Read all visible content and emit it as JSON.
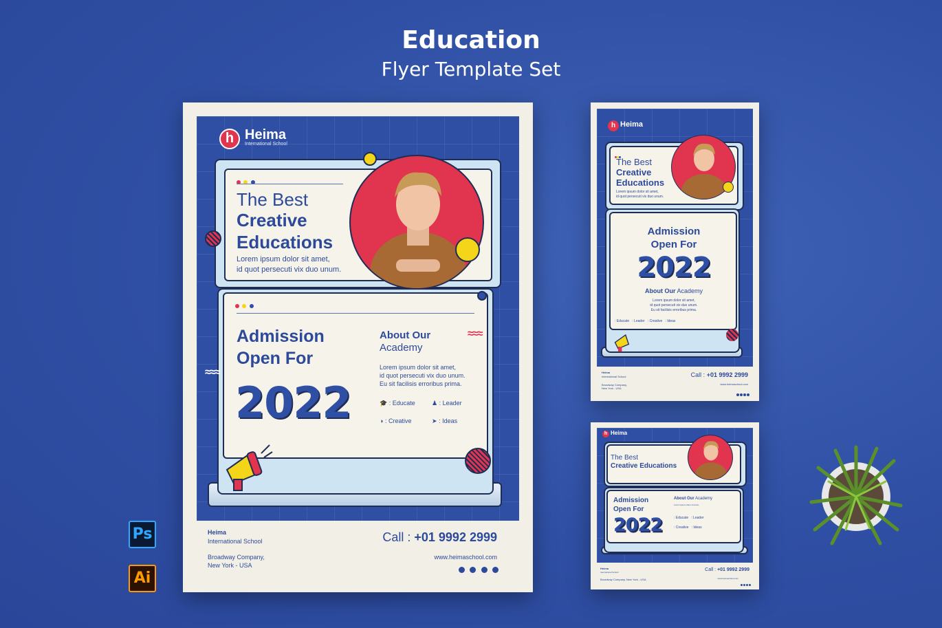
{
  "header": {
    "title": "Education",
    "subtitle": "Flyer Template Set"
  },
  "brand": {
    "name": "Heima",
    "tagline": "International School",
    "logo_letter": "h"
  },
  "hero": {
    "line1": "The Best",
    "line2": "Creative",
    "line3": "Educations",
    "line_square": "Creative Educations",
    "lorem": "Lorem ipsum dolor sit amet,",
    "lorem2": "id quot persecuti vix duo unum."
  },
  "admission": {
    "line1": "Admission",
    "line2": "Open For",
    "year": "2022"
  },
  "about": {
    "title1": "About Our",
    "title2": "Academy",
    "body1": "Lorem ipsum dolor sit amet,",
    "body2": "id quot persecuti vix duo unum.",
    "body3": "Eu sit facilisis erroribus prima.",
    "features": [
      ": Educate",
      ": Leader",
      ": Creative",
      ": Ideas"
    ]
  },
  "footer": {
    "company1": "Broadway Company,",
    "company2": "New York - USA",
    "company_line": "Broadway Company, New York - USA",
    "call_label": "Call :",
    "phone": "+01 9992 2999",
    "website": "www.heimaschool.com"
  },
  "apps": {
    "ps": "Ps",
    "ai": "Ai"
  },
  "colors": {
    "background": "#2f4fa4",
    "accent_red": "#e0344f",
    "accent_yellow": "#f5d51a",
    "cream": "#f2efe6",
    "light_blue": "#cfe4f2"
  }
}
